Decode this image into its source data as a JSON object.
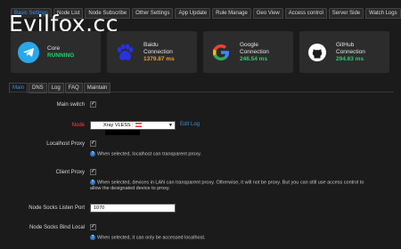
{
  "topnav": [
    "Basic Settings",
    "Node List",
    "Node Subscribe",
    "Other Settings",
    "App Update",
    "Rule Manage",
    "Geo View",
    "Access control",
    "Server Side",
    "Watch Logs"
  ],
  "brand": "Evilfox.cc",
  "cards": [
    {
      "name": "Core",
      "status": "RUNNING",
      "color": "#2ecc71"
    },
    {
      "name": "Baidu",
      "sub": "Connection",
      "status": "1379.87 ms",
      "color": "#e8a032"
    },
    {
      "name": "Google",
      "sub": "Connection",
      "status": "246.54 ms",
      "color": "#2ecc71"
    },
    {
      "name": "GitHub",
      "sub": "Connection",
      "status": "294.63 ms",
      "color": "#2ecc71"
    }
  ],
  "subtabs": [
    "Main",
    "DNS",
    "Log",
    "FAQ",
    "Maintain"
  ],
  "form": {
    "main_switch": "Main switch",
    "node": "Node",
    "node_value": "Xray VLESS :",
    "edit_log": "Edit Log",
    "localhost_proxy": "Localhost Proxy",
    "localhost_help": "When selected, localhost can transparent proxy.",
    "client_proxy": "Client Proxy",
    "client_help_1": "When selected, devices in LAN can transparent proxy. Otherwise, it will not be proxy. But you can still use access control to",
    "client_help_2": "allow the designated device to proxy.",
    "socks_port": "Node Socks Listen Port",
    "socks_port_value": "1070",
    "socks_bind": "Node Socks Bind Local",
    "socks_bind_help": "When selected, it can only be accessed localhost."
  }
}
